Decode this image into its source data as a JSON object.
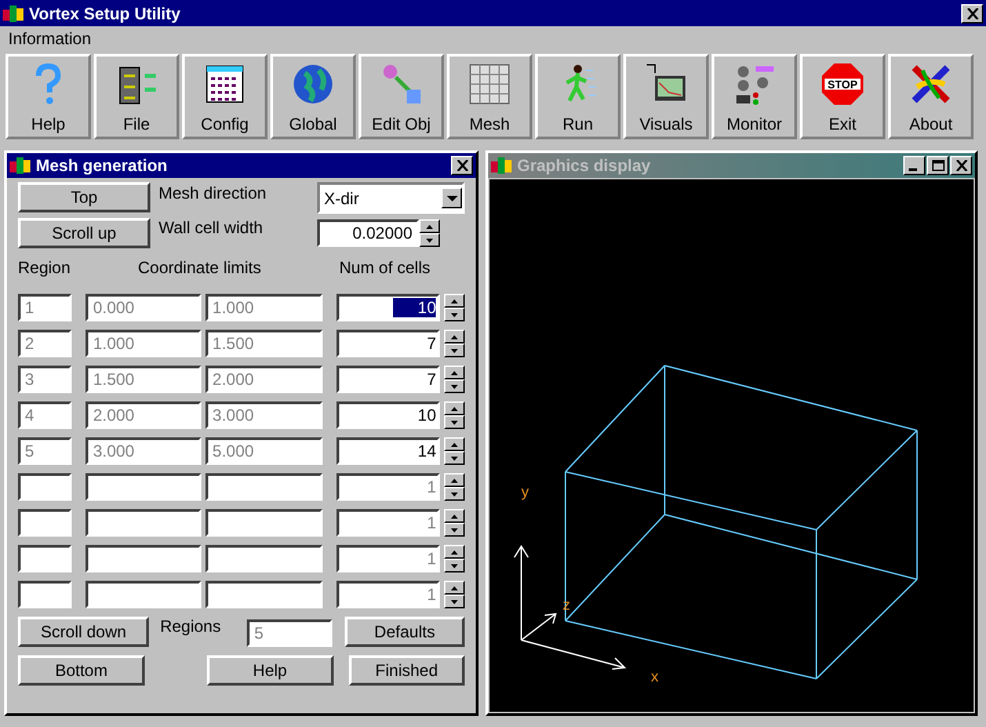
{
  "window": {
    "title": "Vortex Setup Utility"
  },
  "menu": [
    "Information"
  ],
  "toolbar": [
    {
      "label": "Help"
    },
    {
      "label": "File"
    },
    {
      "label": "Config"
    },
    {
      "label": "Global"
    },
    {
      "label": "Edit Obj"
    },
    {
      "label": "Mesh"
    },
    {
      "label": "Run"
    },
    {
      "label": "Visuals"
    },
    {
      "label": "Monitor"
    },
    {
      "label": "Exit",
      "sign": "STOP"
    },
    {
      "label": "About"
    }
  ],
  "mesh_panel": {
    "title": "Mesh generation",
    "top_button": "Top",
    "scroll_up_button": "Scroll up",
    "direction_label": "Mesh direction",
    "direction_value": "X-dir",
    "wall_label": "Wall cell width",
    "wall_value": "0.02000",
    "headers": [
      "Region",
      "Coordinate limits",
      "Num of cells"
    ],
    "rows": [
      {
        "region": "1",
        "from": "0.000",
        "to": "1.000",
        "cells": "10",
        "selected": true,
        "disabled": false
      },
      {
        "region": "2",
        "from": "1.000",
        "to": "1.500",
        "cells": "7",
        "selected": false,
        "disabled": false
      },
      {
        "region": "3",
        "from": "1.500",
        "to": "2.000",
        "cells": "7",
        "selected": false,
        "disabled": false
      },
      {
        "region": "4",
        "from": "2.000",
        "to": "3.000",
        "cells": "10",
        "selected": false,
        "disabled": false
      },
      {
        "region": "5",
        "from": "3.000",
        "to": "5.000",
        "cells": "14",
        "selected": false,
        "disabled": false
      },
      {
        "cells": "1",
        "selected": false,
        "disabled": true
      },
      {
        "cells": "1",
        "selected": false,
        "disabled": true
      },
      {
        "cells": "1",
        "selected": false,
        "disabled": true
      },
      {
        "cells": "1",
        "selected": false,
        "disabled": true
      }
    ],
    "scroll_down_button": "Scroll down",
    "regions_label": "Regions",
    "regions_value": "5",
    "defaults_button": "Defaults",
    "bottom_button": "Bottom",
    "help_button": "Help",
    "finished_button": "Finished"
  },
  "graphics": {
    "title": "Graphics display",
    "active": false,
    "axes": [
      "y",
      "z",
      "x"
    ]
  }
}
